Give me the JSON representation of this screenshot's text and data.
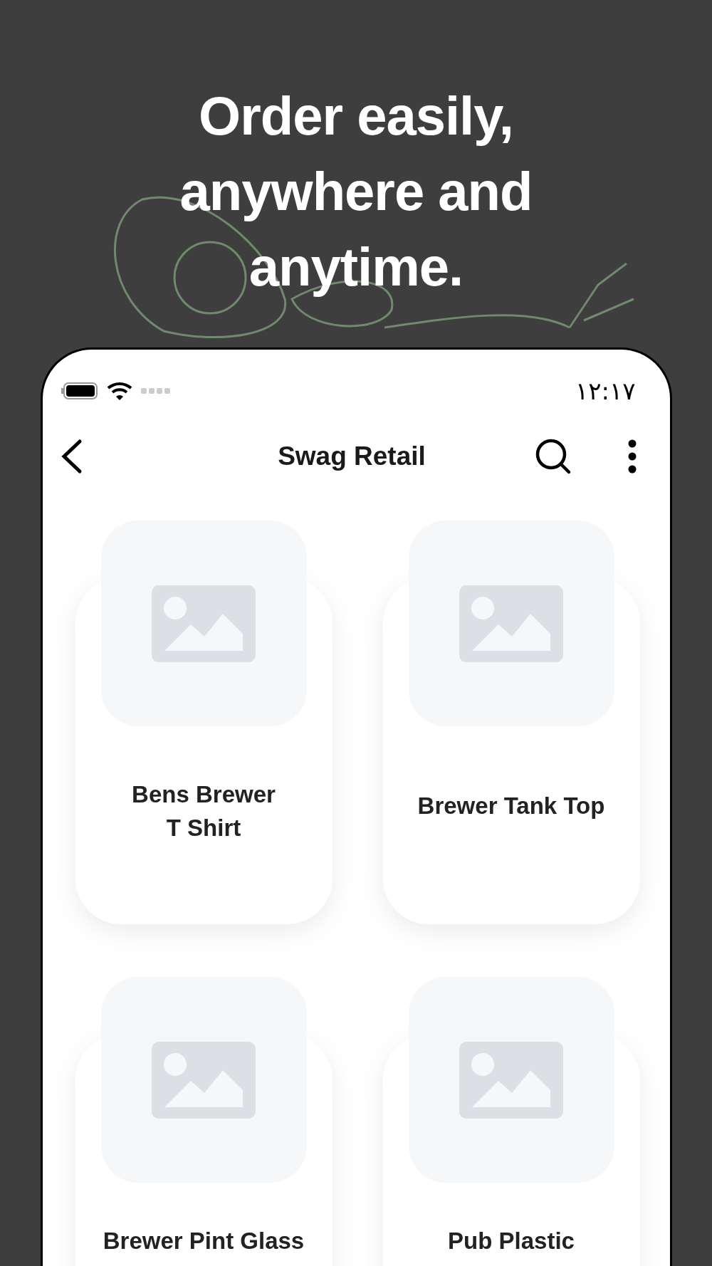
{
  "headline": [
    "Order easily,",
    "anywhere and",
    "anytime."
  ],
  "status_bar": {
    "time": "۱۲:۱۷"
  },
  "app_bar": {
    "title": "Swag Retail"
  },
  "products": [
    {
      "name": "Bens Brewer\nT Shirt"
    },
    {
      "name": "Brewer Tank Top"
    },
    {
      "name": "Brewer Pint Glass"
    },
    {
      "name": "Pub Plastic"
    }
  ]
}
